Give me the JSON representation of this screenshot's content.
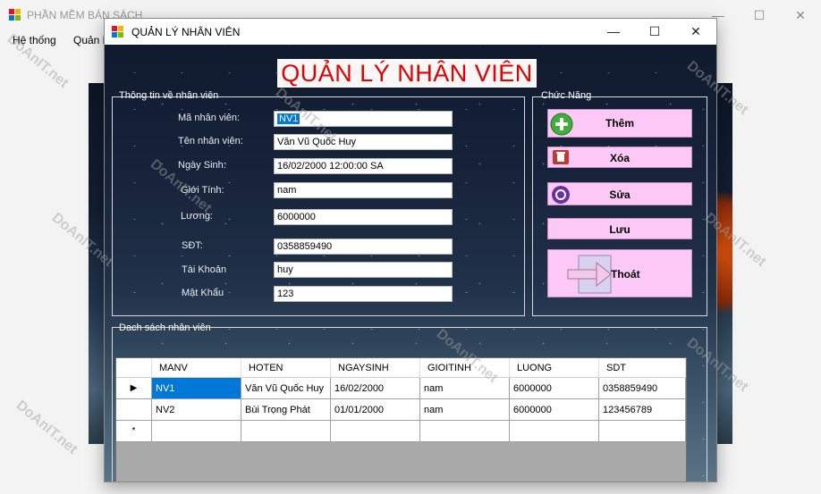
{
  "parent": {
    "title": "PHẦN MỀM BÁN SÁCH",
    "menu": [
      "Hệ thống",
      "Quản l"
    ]
  },
  "dialog": {
    "title": "QUẢN LÝ NHÂN VIÊN",
    "banner": "QUẢN LÝ NHÂN VIÊN",
    "info_group": {
      "label": "Thông tin về nhân viên",
      "fields": [
        {
          "label": "Mã nhân viên:",
          "value": "NV1"
        },
        {
          "label": "Tên nhân viên:",
          "value": "Văn Vũ Quốc Huy"
        },
        {
          "label": "Ngày Sinh:",
          "value": "16/02/2000 12:00:00 SA"
        },
        {
          "label": "Giới Tính:",
          "value": "nam"
        },
        {
          "label": "Lương:",
          "value": "6000000"
        },
        {
          "label": "SĐT:",
          "value": "0358859490"
        },
        {
          "label": "Tài Khoản",
          "value": "huy"
        },
        {
          "label": "Mật Khẩu",
          "value": "123"
        }
      ]
    },
    "function_group": {
      "label": "Chức Năng",
      "buttons": {
        "add": "Thêm",
        "delete": "Xóa",
        "edit": "Sửa",
        "save": "Lưu",
        "exit": "Thoát"
      }
    },
    "list_group": {
      "label": "Dach sách nhân viên",
      "columns": [
        "MANV",
        "HOTEN",
        "NGAYSINH",
        "GIOITINH",
        "LUONG",
        "SDT"
      ],
      "rows": [
        [
          "NV1",
          "Văn Vũ Quốc Huy",
          "16/02/2000",
          "nam",
          "6000000",
          "0358859490"
        ],
        [
          "NV2",
          "Bùi Trọng Phát",
          "01/01/2000",
          "nam",
          "6000000",
          "123456789"
        ]
      ],
      "current_row_marker": "▶",
      "new_row_marker": "*"
    }
  },
  "watermark": "DoAnIT.net",
  "colors": {
    "banner_text": "#e00000",
    "button_bg": "#fcc9f6",
    "selection": "#0078d7"
  }
}
